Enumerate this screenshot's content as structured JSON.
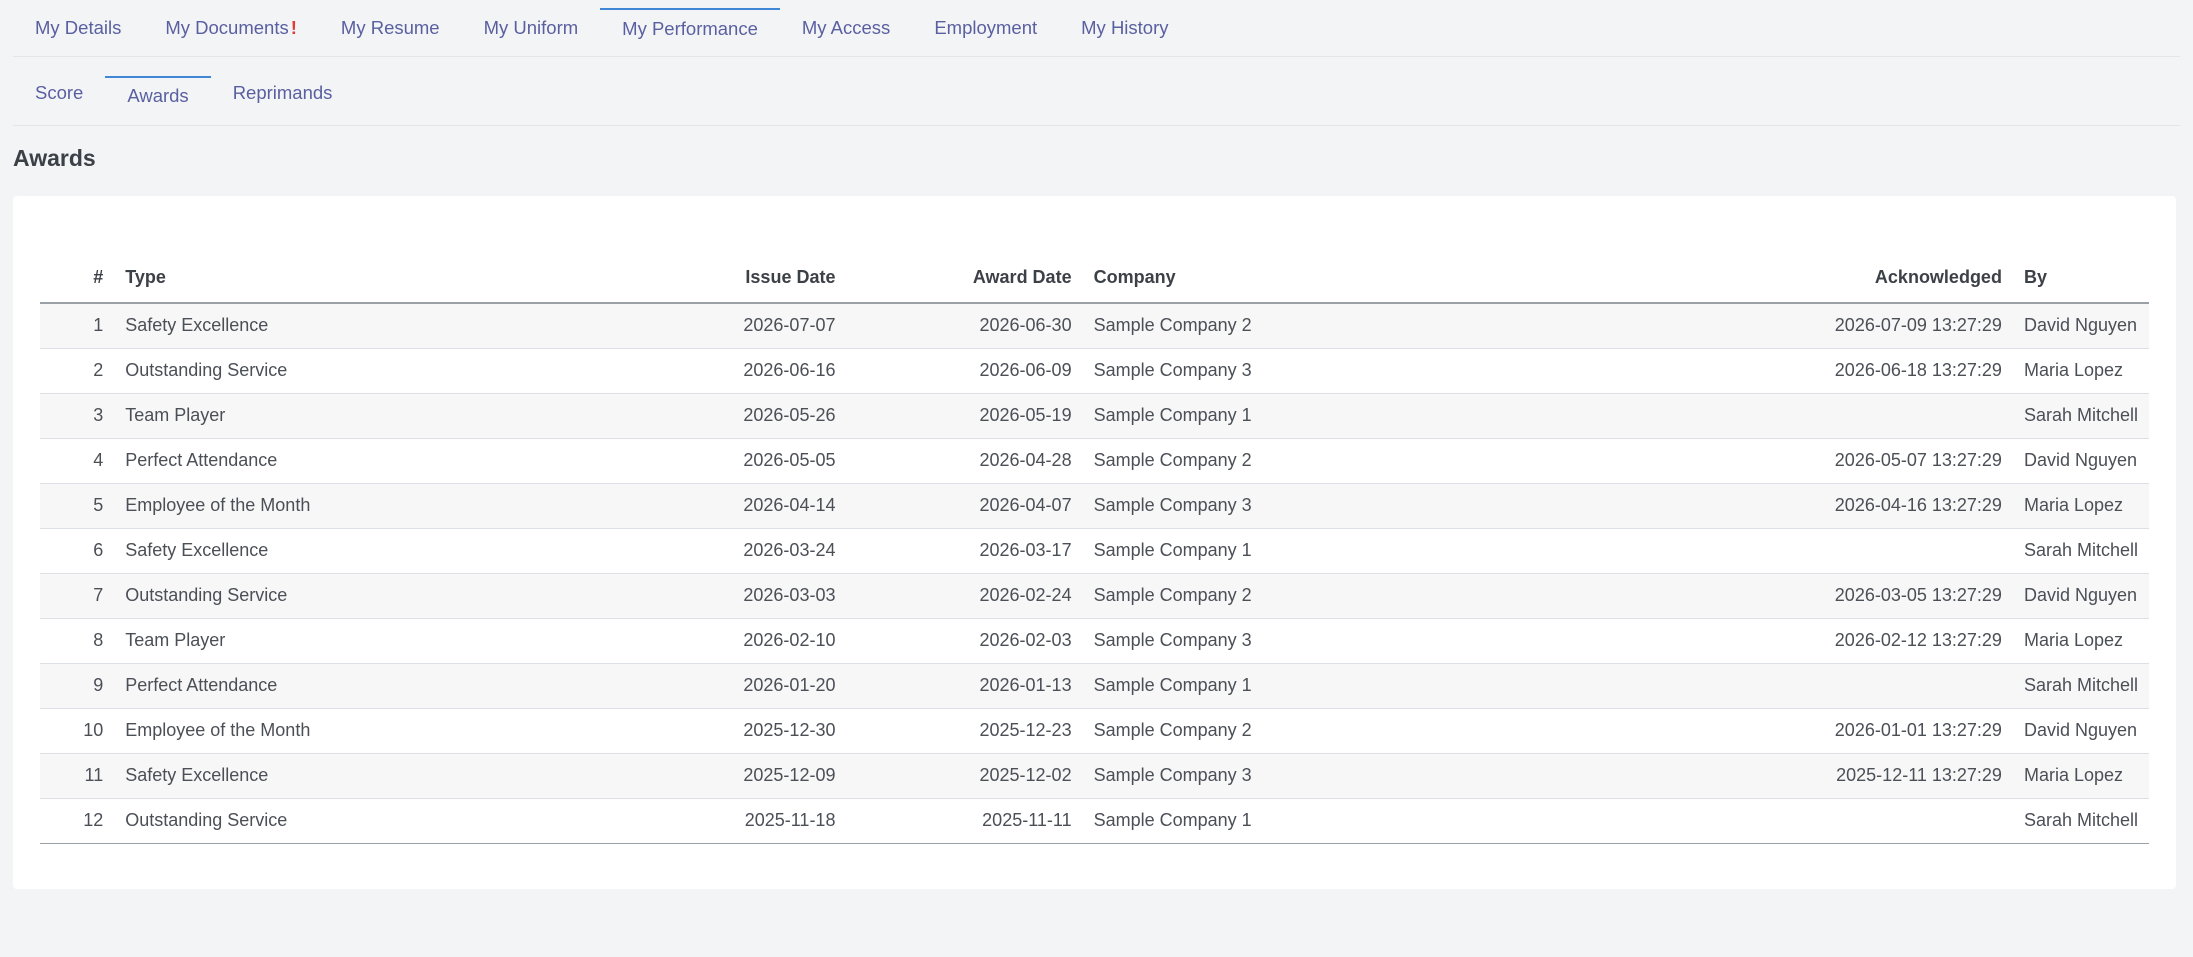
{
  "main_tabs": [
    {
      "label": "My Details",
      "active": false
    },
    {
      "label": "My Documents",
      "active": false,
      "alert": "!"
    },
    {
      "label": "My Resume",
      "active": false
    },
    {
      "label": "My Uniform",
      "active": false
    },
    {
      "label": "My Performance",
      "active": true
    },
    {
      "label": "My Access",
      "active": false
    },
    {
      "label": "Employment",
      "active": false
    },
    {
      "label": "My History",
      "active": false
    }
  ],
  "sub_tabs": [
    {
      "label": "Score",
      "active": false
    },
    {
      "label": "Awards",
      "active": true
    },
    {
      "label": "Reprimands",
      "active": false
    }
  ],
  "section_title": "Awards",
  "table": {
    "headers": {
      "num": "#",
      "type": "Type",
      "issue_date": "Issue Date",
      "award_date": "Award Date",
      "company": "Company",
      "acknowledged": "Acknowledged",
      "by": "By"
    },
    "rows": [
      {
        "num": "1",
        "type": "Safety Excellence",
        "issue_date": "2026-07-07",
        "award_date": "2026-06-30",
        "company": "Sample Company 2",
        "acknowledged": "2026-07-09 13:27:29",
        "by": "David Nguyen"
      },
      {
        "num": "2",
        "type": "Outstanding Service",
        "issue_date": "2026-06-16",
        "award_date": "2026-06-09",
        "company": "Sample Company 3",
        "acknowledged": "2026-06-18 13:27:29",
        "by": "Maria Lopez"
      },
      {
        "num": "3",
        "type": "Team Player",
        "issue_date": "2026-05-26",
        "award_date": "2026-05-19",
        "company": "Sample Company 1",
        "acknowledged": "",
        "by": "Sarah Mitchell"
      },
      {
        "num": "4",
        "type": "Perfect Attendance",
        "issue_date": "2026-05-05",
        "award_date": "2026-04-28",
        "company": "Sample Company 2",
        "acknowledged": "2026-05-07 13:27:29",
        "by": "David Nguyen"
      },
      {
        "num": "5",
        "type": "Employee of the Month",
        "issue_date": "2026-04-14",
        "award_date": "2026-04-07",
        "company": "Sample Company 3",
        "acknowledged": "2026-04-16 13:27:29",
        "by": "Maria Lopez"
      },
      {
        "num": "6",
        "type": "Safety Excellence",
        "issue_date": "2026-03-24",
        "award_date": "2026-03-17",
        "company": "Sample Company 1",
        "acknowledged": "",
        "by": "Sarah Mitchell"
      },
      {
        "num": "7",
        "type": "Outstanding Service",
        "issue_date": "2026-03-03",
        "award_date": "2026-02-24",
        "company": "Sample Company 2",
        "acknowledged": "2026-03-05 13:27:29",
        "by": "David Nguyen"
      },
      {
        "num": "8",
        "type": "Team Player",
        "issue_date": "2026-02-10",
        "award_date": "2026-02-03",
        "company": "Sample Company 3",
        "acknowledged": "2026-02-12 13:27:29",
        "by": "Maria Lopez"
      },
      {
        "num": "9",
        "type": "Perfect Attendance",
        "issue_date": "2026-01-20",
        "award_date": "2026-01-13",
        "company": "Sample Company 1",
        "acknowledged": "",
        "by": "Sarah Mitchell"
      },
      {
        "num": "10",
        "type": "Employee of the Month",
        "issue_date": "2025-12-30",
        "award_date": "2025-12-23",
        "company": "Sample Company 2",
        "acknowledged": "2026-01-01 13:27:29",
        "by": "David Nguyen"
      },
      {
        "num": "11",
        "type": "Safety Excellence",
        "issue_date": "2025-12-09",
        "award_date": "2025-12-02",
        "company": "Sample Company 3",
        "acknowledged": "2025-12-11 13:27:29",
        "by": "Maria Lopez"
      },
      {
        "num": "12",
        "type": "Outstanding Service",
        "issue_date": "2025-11-18",
        "award_date": "2025-11-11",
        "company": "Sample Company 1",
        "acknowledged": "",
        "by": "Sarah Mitchell"
      }
    ]
  }
}
